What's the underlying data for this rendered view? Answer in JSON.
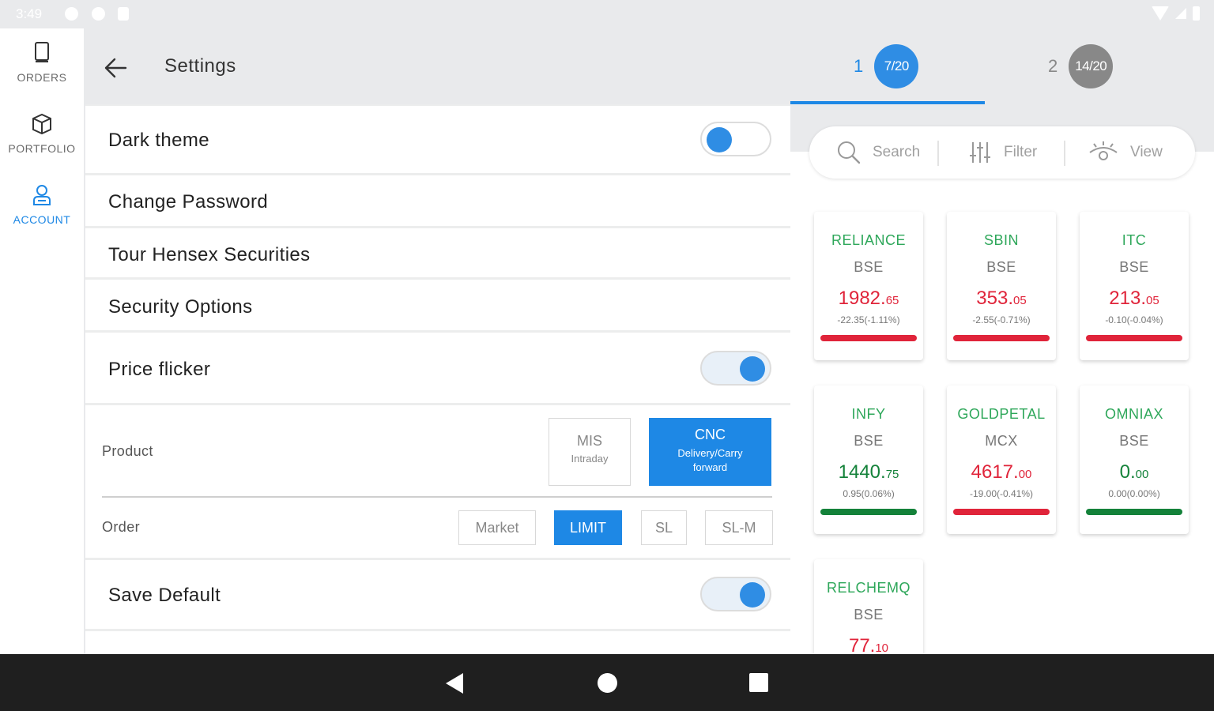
{
  "status_bar": {
    "time": "3:49"
  },
  "left_nav": {
    "items": [
      {
        "label": "ORDERS",
        "icon": "orders-icon"
      },
      {
        "label": "PORTFOLIO",
        "icon": "portfolio-icon"
      },
      {
        "label": "ACCOUNT",
        "icon": "account-icon",
        "active": true
      }
    ]
  },
  "settings": {
    "title": "Settings",
    "dark_theme": {
      "label": "Dark theme",
      "on": false
    },
    "change_password": "Change Password",
    "tour": "Tour Hensex Securities",
    "security_options": "Security Options",
    "price_flicker": {
      "label": "Price flicker",
      "on": true
    },
    "product": {
      "label": "Product",
      "options": [
        {
          "main": "MIS",
          "sub": "Intraday",
          "selected": false
        },
        {
          "main": "CNC",
          "sub": "Delivery/Carry forward",
          "selected": true
        }
      ]
    },
    "order": {
      "label": "Order",
      "options": [
        {
          "label": "Market",
          "selected": false
        },
        {
          "label": "LIMIT",
          "selected": true
        },
        {
          "label": "SL",
          "selected": false
        },
        {
          "label": "SL-M",
          "selected": false
        }
      ]
    },
    "save_default": {
      "label": "Save Default",
      "on": true
    }
  },
  "watchlist": {
    "tabs": [
      {
        "number": "1",
        "badge": "7/20",
        "active": true
      },
      {
        "number": "2",
        "badge": "14/20",
        "active": false
      }
    ],
    "toolbar": {
      "search": "Search",
      "filter": "Filter",
      "view": "View"
    },
    "cards": [
      {
        "symbol": "RELIANCE",
        "exchange": "BSE",
        "price_int": "1982.",
        "price_dec": "65",
        "change": "-22.35(-1.11%)",
        "trend": "red"
      },
      {
        "symbol": "SBIN",
        "exchange": "BSE",
        "price_int": "353.",
        "price_dec": "05",
        "change": "-2.55(-0.71%)",
        "trend": "red"
      },
      {
        "symbol": "ITC",
        "exchange": "BSE",
        "price_int": "213.",
        "price_dec": "05",
        "change": "-0.10(-0.04%)",
        "trend": "red"
      },
      {
        "symbol": "INFY",
        "exchange": "BSE",
        "price_int": "1440.",
        "price_dec": "75",
        "change": "0.95(0.06%)",
        "trend": "green"
      },
      {
        "symbol": "GOLDPETAL",
        "exchange": "MCX",
        "price_int": "4617.",
        "price_dec": "00",
        "change": "-19.00(-0.41%)",
        "trend": "red"
      },
      {
        "symbol": "OMNIAX",
        "exchange": "BSE",
        "price_int": "0.",
        "price_dec": "00",
        "change": "0.00(0.00%)",
        "trend": "green"
      },
      {
        "symbol": "RELCHEMQ",
        "exchange": "BSE",
        "price_int": "77.",
        "price_dec": "10",
        "change": "",
        "trend": "red"
      }
    ]
  },
  "colors": {
    "accent": "#1e88e5",
    "positive": "#14823a",
    "negative": "#e0243a",
    "symbol": "#2ea75a"
  }
}
